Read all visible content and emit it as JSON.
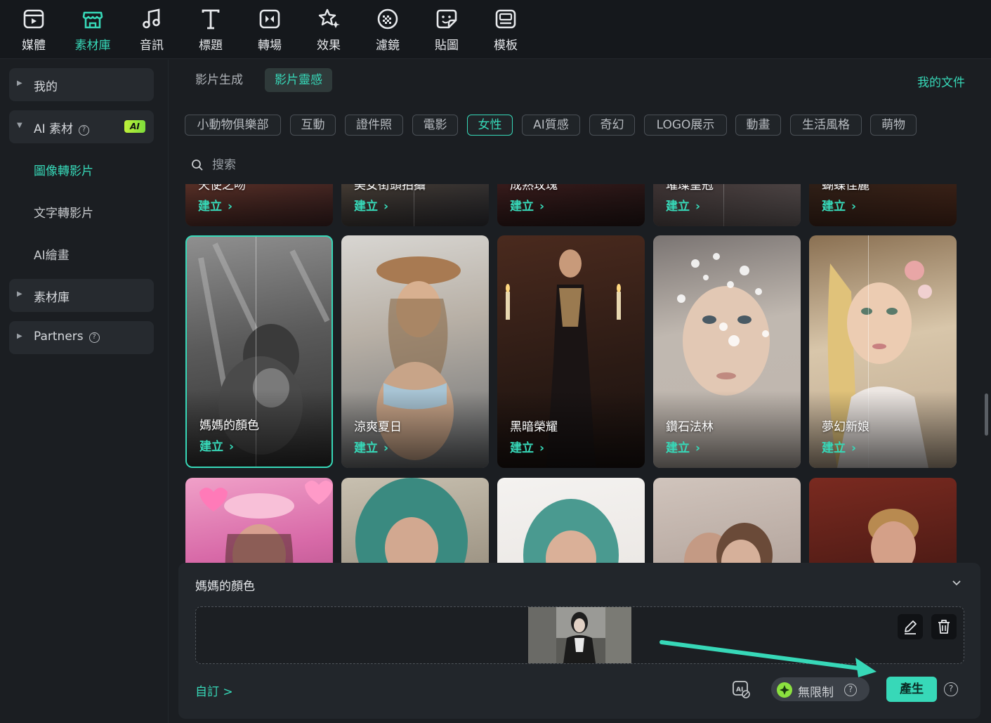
{
  "toolbar": {
    "items": [
      {
        "label": "媒體",
        "icon": "media-icon"
      },
      {
        "label": "素材庫",
        "icon": "store-icon",
        "active": true
      },
      {
        "label": "音訊",
        "icon": "music-note-icon"
      },
      {
        "label": "標題",
        "icon": "text-t-icon"
      },
      {
        "label": "轉場",
        "icon": "transition-icon"
      },
      {
        "label": "效果",
        "icon": "effects-star-icon"
      },
      {
        "label": "濾鏡",
        "icon": "filter-icon"
      },
      {
        "label": "貼圖",
        "icon": "sticker-icon"
      },
      {
        "label": "模板",
        "icon": "template-icon"
      }
    ]
  },
  "sidebar": {
    "my": "我的",
    "ai_assets": "AI 素材",
    "ai_badge": "AI",
    "sub_items": [
      "圖像轉影片",
      "文字轉影片",
      "AI繪畫"
    ],
    "library": "素材庫",
    "partners": "Partners"
  },
  "tabs": {
    "video_gen": "影片生成",
    "inspiration": "影片靈感",
    "my_docs": "我的文件"
  },
  "chips": [
    "小動物俱樂部",
    "互動",
    "證件照",
    "電影",
    "女性",
    "AI質感",
    "奇幻",
    "LOGO展示",
    "動畫",
    "生活風格",
    "萌物"
  ],
  "active_chip": "女性",
  "search": {
    "placeholder": "搜索"
  },
  "create_label": "建立",
  "row_top_titles": [
    "天使之吻",
    "美女街頭拍攝",
    "成熟玫瑰",
    "璀璨皇冠",
    "蝴蝶佳麗"
  ],
  "row_main_titles": [
    "媽媽的顏色",
    "涼爽夏日",
    "黑暗榮耀",
    "鑽石法林",
    "夢幻新娘"
  ],
  "panel": {
    "title": "媽媽的顏色",
    "custom": "自訂 >",
    "unlimited": "無限制",
    "generate": "產生"
  },
  "colors": {
    "accent": "#37d8b8",
    "background": "#1b1e22",
    "panel": "#22262b"
  }
}
